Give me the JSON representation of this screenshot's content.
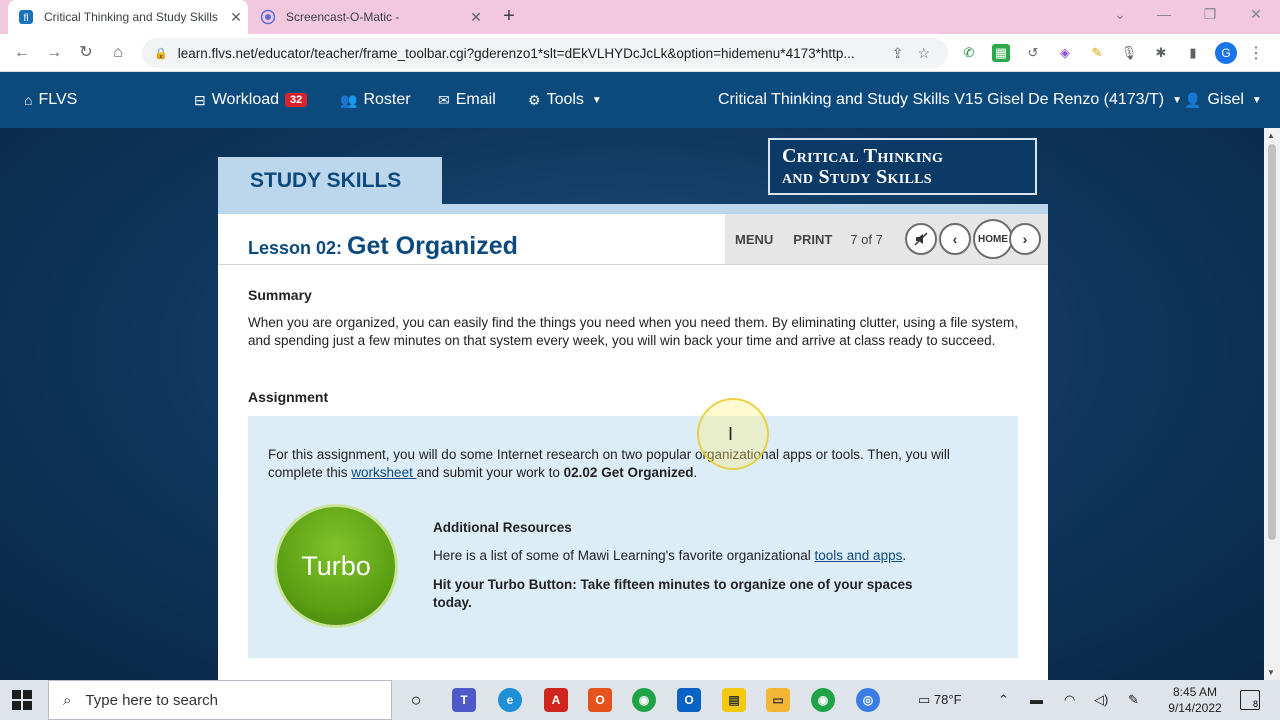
{
  "browser": {
    "tabs": [
      {
        "title": "Critical Thinking and Study Skills",
        "active": true
      },
      {
        "title": "Screencast-O-Matic -",
        "active": false
      }
    ],
    "new_tab": "+",
    "address": "learn.flvs.net/educator/teacher/frame_toolbar.cgi?gderenzo1*slt=dEkVLHYDcJcLk&option=hidemenu*4173*http...",
    "profile_initial": "G"
  },
  "navbar": {
    "home": "FLVS",
    "workload": "Workload",
    "workload_count": "32",
    "roster": "Roster",
    "email": "Email",
    "tools": "Tools",
    "course": "Critical Thinking and Study Skills V15 Gisel De Renzo (4173/T)",
    "user": "Gisel"
  },
  "course": {
    "tab_label": "STUDY SKILLS",
    "logo_line1": "Critical Thinking",
    "logo_line2": "and Study Skills",
    "lesson_prefix": "Lesson 02: ",
    "lesson_title": "Get Organized",
    "nav": {
      "menu": "MENU",
      "print": "PRINT",
      "page": "7 of 7",
      "home": "HOME"
    },
    "summary_heading": "Summary",
    "summary_text": "When you are organized, you can easily find the things you need when you need them. By eliminating clutter, using a file system, and spending just a few minutes on that system every week, you will win back your time and arrive at class ready to succeed.",
    "assignment_heading": "Assignment",
    "assignment_text_1": "For this assignment, you will do some Internet research on two popular organizational apps or tools. Then, you will complete this ",
    "assignment_link": "worksheet ",
    "assignment_text_2": "and submit your work to ",
    "assignment_target": "02.02 Get Organized",
    "assignment_text_3": ".",
    "turbo_label": "Turbo",
    "resources_heading": "Additional Resources",
    "resources_text_1": "Here is a list of some of Mawi Learning's favorite organizational ",
    "resources_link": "tools and apps",
    "resources_text_2": ".",
    "turbo_button_text": "Hit your Turbo Button: Take fifteen minutes to organize one of your spaces today."
  },
  "taskbar": {
    "search_placeholder": "Type here to search",
    "weather": "78°F",
    "time": "8:45 AM",
    "date": "9/14/2022",
    "notifications": "8"
  }
}
